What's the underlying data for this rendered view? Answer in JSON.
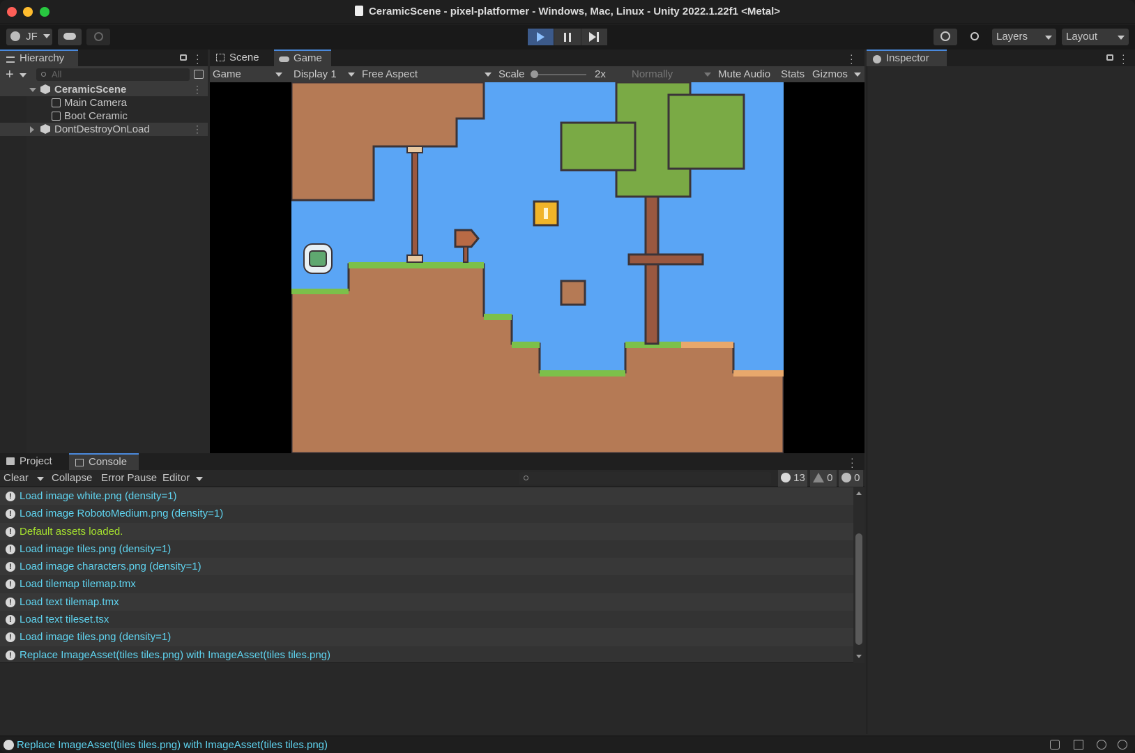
{
  "window": {
    "title": "CeramicScene - pixel-platformer - Windows, Mac, Linux - Unity 2022.1.22f1 <Metal>"
  },
  "toolbar": {
    "account": "JF",
    "layers": "Layers",
    "layout": "Layout"
  },
  "hierarchy": {
    "tab": "Hierarchy",
    "search_placeholder": "All",
    "items": [
      {
        "label": "CeramicScene"
      },
      {
        "label": "Main Camera"
      },
      {
        "label": "Boot Ceramic"
      },
      {
        "label": "DontDestroyOnLoad"
      }
    ]
  },
  "game_panel": {
    "tabs": [
      {
        "label": "Scene"
      },
      {
        "label": "Game"
      }
    ],
    "game_dropdown": "Game",
    "display": "Display 1",
    "aspect": "Free Aspect",
    "scale_label": "Scale",
    "scale_value": "2x",
    "normally": "Normally",
    "mute_audio": "Mute Audio",
    "stats": "Stats",
    "gizmos": "Gizmos"
  },
  "inspector": {
    "tab": "Inspector"
  },
  "bottom_panel": {
    "tabs": [
      {
        "label": "Project"
      },
      {
        "label": "Console"
      }
    ],
    "clear": "Clear",
    "collapse": "Collapse",
    "error_pause": "Error Pause",
    "editor": "Editor",
    "counts": {
      "info": "13",
      "warn": "0",
      "error": "0"
    },
    "logs": [
      {
        "text": "Load image white.png (density=1)",
        "color": "#5fd4f0"
      },
      {
        "text": "Load image RobotoMedium.png (density=1)",
        "color": "#5fd4f0"
      },
      {
        "text": "Default assets loaded.",
        "color": "#a6e22e"
      },
      {
        "text": "Load image tiles.png (density=1)",
        "color": "#5fd4f0"
      },
      {
        "text": "Load image characters.png (density=1)",
        "color": "#5fd4f0"
      },
      {
        "text": "Load tilemap tilemap.tmx",
        "color": "#5fd4f0"
      },
      {
        "text": "Load text tilemap.tmx",
        "color": "#5fd4f0"
      },
      {
        "text": "Load text tileset.tsx",
        "color": "#5fd4f0"
      },
      {
        "text": "Load image tiles.png (density=1)",
        "color": "#5fd4f0"
      },
      {
        "text": "Replace ImageAsset(tiles tiles.png) with ImageAsset(tiles tiles.png)",
        "color": "#5fd4f0"
      }
    ]
  },
  "statusbar": {
    "text": "Replace ImageAsset(tiles tiles.png) with ImageAsset(tiles tiles.png)"
  },
  "colors": {
    "sky": "#5aa5f5",
    "dirt": "#b57a55",
    "grass": "#7cc04a",
    "leaf": "#7aaa45",
    "trunk": "#9a5840",
    "accent": "#4a89dc"
  }
}
